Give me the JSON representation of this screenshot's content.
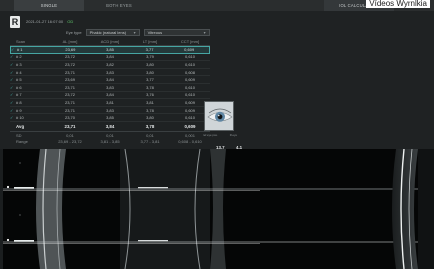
{
  "caption": "Vídeos Wyrnlkia",
  "tabs": [
    {
      "label": "SINGLE",
      "active": true
    },
    {
      "label": "BOTH EYES",
      "active": false
    },
    {
      "label": "",
      "active": false
    },
    {
      "label": "",
      "active": false
    },
    {
      "label": "",
      "active": false
    },
    {
      "label": "IOL CALCULATION",
      "active": false
    }
  ],
  "logo": "R",
  "patient": {
    "info": "2021-01-27 16:07:00",
    "eye": "OD"
  },
  "iol_row": {
    "label": "Eye type",
    "type_value": "Phakic (natural lens)",
    "second_value": "Vitreous"
  },
  "table": {
    "headers": [
      "Scan",
      "AL [mm]",
      "ACD [mm]",
      "LT [mm]",
      "CCT [mm]"
    ],
    "rows": [
      {
        "scan": "# 1",
        "al": "23,69",
        "acd": "3,85",
        "lt": "3,77",
        "cct": "0,609"
      },
      {
        "scan": "# 2",
        "al": "23,72",
        "acd": "3,84",
        "lt": "3,79",
        "cct": "0,610"
      },
      {
        "scan": "# 3",
        "al": "23,72",
        "acd": "3,82",
        "lt": "3,80",
        "cct": "0,610"
      },
      {
        "scan": "# 4",
        "al": "23,71",
        "acd": "3,83",
        "lt": "3,80",
        "cct": "0,608"
      },
      {
        "scan": "# 5",
        "al": "23,69",
        "acd": "3,84",
        "lt": "3,77",
        "cct": "0,609"
      },
      {
        "scan": "# 6",
        "al": "23,71",
        "acd": "3,83",
        "lt": "3,78",
        "cct": "0,610"
      },
      {
        "scan": "# 7",
        "al": "23,72",
        "acd": "3,84",
        "lt": "3,76",
        "cct": "0,610"
      },
      {
        "scan": "# 8",
        "al": "23,71",
        "acd": "3,81",
        "lt": "3,81",
        "cct": "0,609"
      },
      {
        "scan": "# 9",
        "al": "23,71",
        "acd": "3,83",
        "lt": "3,78",
        "cct": "0,609"
      },
      {
        "scan": "# 10",
        "al": "23,70",
        "acd": "3,85",
        "lt": "3,80",
        "cct": "0,610"
      }
    ],
    "avg": {
      "label": "Avg",
      "al": "23,71",
      "acd": "3,84",
      "lt": "3,78",
      "cct": "0,609",
      "extra1": "13,7",
      "extra2": "4,1"
    },
    "sd": {
      "label": "SD",
      "al": "0,01",
      "acd": "0,01",
      "lt": "0,01",
      "cct": "0,001"
    },
    "range": {
      "label": "Range",
      "al": "23,69 - 23,72",
      "acd": "3,81 - 3,85",
      "lt": "3,77 - 3,81",
      "cct": "0,608 - 0,610"
    }
  },
  "eye_photo_caption": {
    "left": "ref.eye pos.",
    "right": "R.eye"
  },
  "colors": {
    "background": "#1f2223",
    "accent": "#46a6a3",
    "eye_ok": "#5fc46a"
  }
}
